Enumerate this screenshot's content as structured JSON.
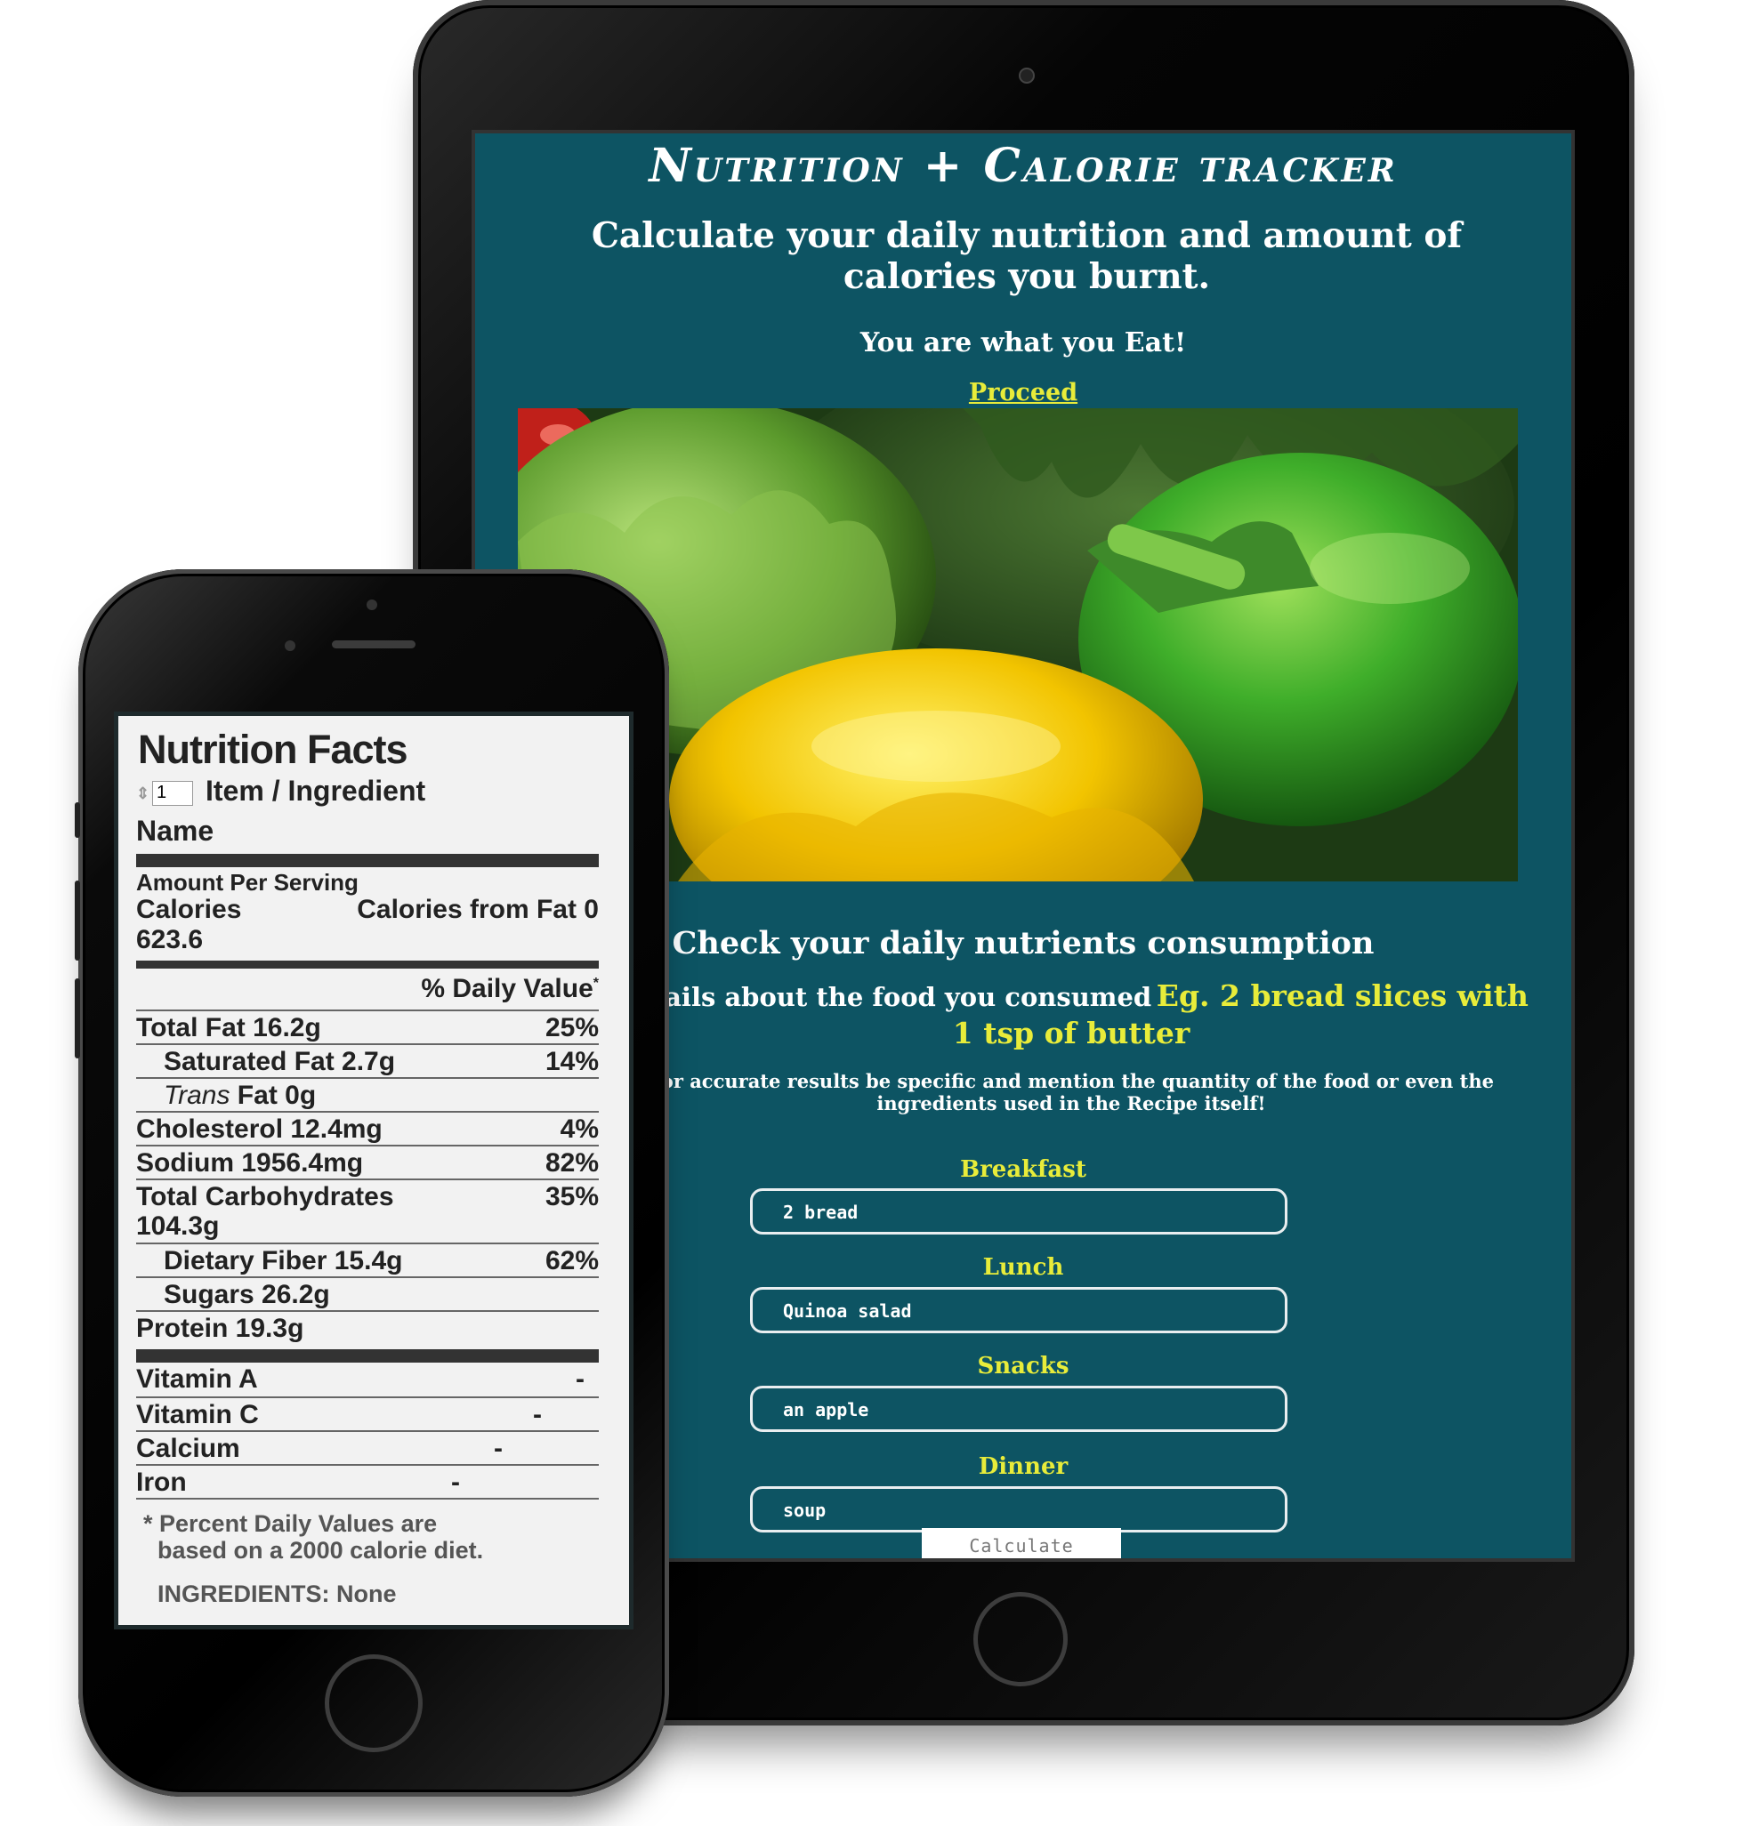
{
  "tablet": {
    "title": "Nutrition + Calorie tracker",
    "subtitle": "Calculate your daily nutrition and amount of calories you burnt.",
    "tagline": "You are what you Eat!",
    "proceed_link": "Proceed",
    "check_heading": "Check your daily nutrients consumption",
    "details_text": "Details about the food you consumed",
    "details_example": "Eg. 2 bread slices with 1 tsp of butter",
    "accuracy_note": "For accurate results be specific and mention the quantity of the food or even the ingredients used in the Recipe itself!",
    "meals": [
      {
        "label": "Breakfast",
        "value": "2 bread"
      },
      {
        "label": "Lunch",
        "value": "Quinoa salad"
      },
      {
        "label": "Snacks",
        "value": "an apple"
      },
      {
        "label": "Dinner",
        "value": "soup"
      }
    ],
    "calculate_button": "Calculate",
    "colors": {
      "background": "#0d5463",
      "accent": "#e8ec3a"
    }
  },
  "phone": {
    "nutrition_facts": {
      "title": "Nutrition Facts",
      "quantity": "1",
      "item_label": "Item / Ingredient",
      "name_label": "Name",
      "amount_per_serving": "Amount Per Serving",
      "calories_label": "Calories",
      "calories_value": "623.6",
      "calories_from_fat": "Calories from Fat 0",
      "daily_value_header": "% Daily Value",
      "daily_value_marker": "*",
      "rows": [
        {
          "label": "Total Fat 16.2g",
          "percent": "25%"
        },
        {
          "label": "Saturated Fat 2.7g",
          "percent": "14%"
        },
        {
          "label_italic": "Trans",
          "label": " Fat 0g",
          "percent": ""
        },
        {
          "label": "Cholesterol 12.4mg",
          "percent": "4%"
        },
        {
          "label": "Sodium 1956.4mg",
          "percent": "82%"
        },
        {
          "label": "Total Carbohydrates",
          "label2": "104.3g",
          "percent": "35%"
        },
        {
          "label": "Dietary Fiber 15.4g",
          "percent": "62%"
        },
        {
          "label": "Sugars 26.2g",
          "percent": ""
        },
        {
          "label": "Protein 19.3g",
          "percent": ""
        }
      ],
      "vitamins": [
        {
          "label": "Vitamin A",
          "value": "-"
        },
        {
          "label": "Vitamin C",
          "value": "-"
        },
        {
          "label": "Calcium",
          "value": "-"
        },
        {
          "label": "Iron",
          "value": "-"
        }
      ],
      "footnote_line1": "* Percent Daily Values are",
      "footnote_line2": "based on a 2000 calorie diet.",
      "ingredients": "INGREDIENTS: None"
    }
  }
}
